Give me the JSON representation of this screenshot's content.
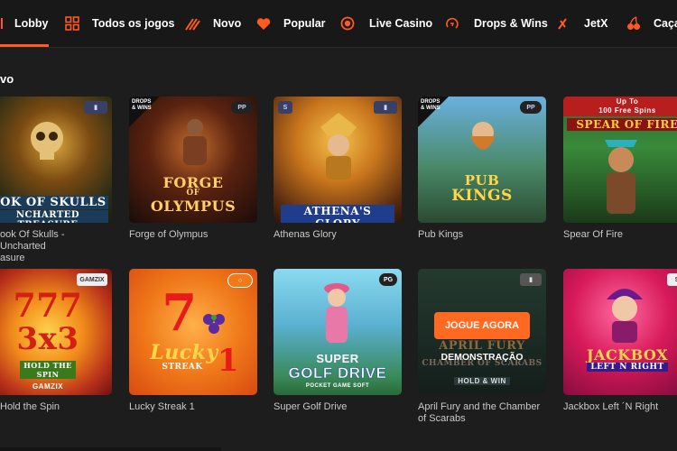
{
  "nav": {
    "items": [
      {
        "label": "Lobby",
        "icon": "lobby-icon",
        "active": true
      },
      {
        "label": "Todos os jogos",
        "icon": "grid-icon"
      },
      {
        "label": "Novo",
        "icon": "fire-icon"
      },
      {
        "label": "Popular",
        "icon": "heart-icon"
      },
      {
        "label": "Live Casino",
        "icon": "live-icon"
      },
      {
        "label": "Drops & Wins",
        "icon": "drops-icon"
      },
      {
        "label": "JetX",
        "icon": "jet-icon"
      },
      {
        "label": "Caça",
        "icon": "cherry-icon"
      }
    ]
  },
  "section": {
    "title": "vo"
  },
  "games": [
    {
      "name": "ook Of Skulls - Uncharted\nasure",
      "art": [
        "OOK OF SKULLS",
        "NCHARTED TREASURE"
      ]
    },
    {
      "name": "Forge of Olympus",
      "art": [
        "FORGE",
        "OF",
        "OLYMPUS"
      ],
      "badge": "DROPS & WINS"
    },
    {
      "name": "Athenas Glory",
      "art": [
        "ATHENA'S GLORY"
      ]
    },
    {
      "name": "Pub Kings",
      "art": [
        "PUB",
        "KINGS"
      ],
      "badge": "DROPS & WINS"
    },
    {
      "name": "Spear Of Fire",
      "art": [
        "Up To",
        "100 Free Spins",
        "SPEAR OF FIRE"
      ]
    },
    {
      "name": " Hold the Spin",
      "art": [
        "777",
        "3x3",
        "HOLD THE SPIN",
        "GAMZIX"
      ],
      "provider": "GAMZIX"
    },
    {
      "name": "Lucky Streak 1",
      "art": [
        "7",
        "Lucky",
        "STREAK",
        "1"
      ]
    },
    {
      "name": "Super Golf Drive",
      "art": [
        "SUPER",
        "GOLF DRIVE",
        "POCKET GAME SOFT"
      ],
      "provider": "PG"
    },
    {
      "name": "April Fury and the Chamber\nof Scarabs",
      "art": [
        "APRIL FURY",
        "CHAMBER OF SCARABS",
        "HOLD & WIN"
      ],
      "cta": "JOGUE AGORA",
      "demo": "DEMONSTRAÇÃO"
    },
    {
      "name": "Jackbox Left ´N Right",
      "art": [
        "JACKBOX",
        "LEFT N RIGHT"
      ]
    }
  ],
  "colors": {
    "accent": "#ff5a1f",
    "background": "#1d1d1d"
  }
}
